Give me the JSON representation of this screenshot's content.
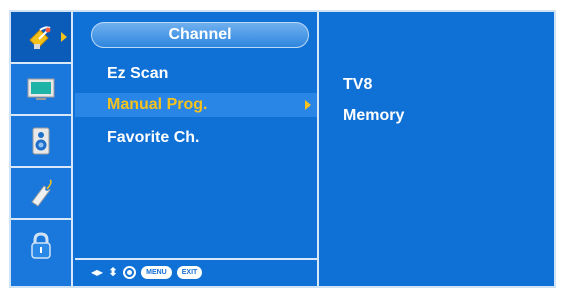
{
  "rail": {
    "items": [
      {
        "icon": "satellite-dish-icon",
        "selected": true
      },
      {
        "icon": "picture-screen-icon",
        "selected": false
      },
      {
        "icon": "speaker-icon",
        "selected": false
      },
      {
        "icon": "tag-icon",
        "selected": false
      },
      {
        "icon": "lock-icon",
        "selected": false
      }
    ]
  },
  "menu": {
    "title": "Channel",
    "items": [
      {
        "label": "Ez Scan",
        "selected": false
      },
      {
        "label": "Manual Prog.",
        "selected": true
      },
      {
        "label": "Favorite Ch.",
        "selected": false
      }
    ]
  },
  "footer": {
    "menu_label": "MENU",
    "exit_label": "EXIT"
  },
  "submenu": {
    "items": [
      {
        "label": "TV8"
      },
      {
        "label": "Memory"
      }
    ]
  },
  "colors": {
    "background": "#0f70d6",
    "highlight": "#2a86e6",
    "selected_text": "#f4c21c",
    "text": "#ffffff"
  }
}
